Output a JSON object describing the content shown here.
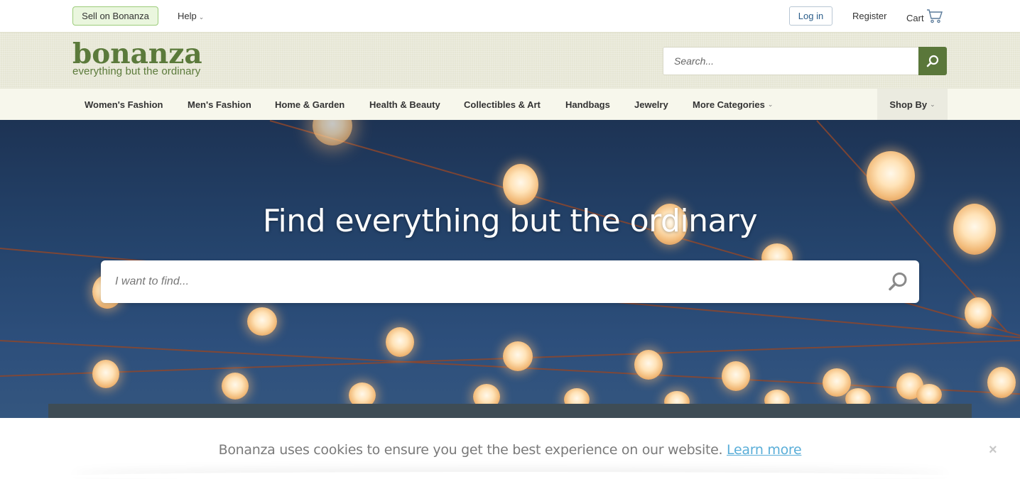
{
  "topbar": {
    "sell_label": "Sell on Bonanza",
    "help_label": "Help",
    "login_label": "Log in",
    "register_label": "Register",
    "cart_label": "Cart"
  },
  "header": {
    "logo_word": "bonanza",
    "logo_tagline": "everything but the ordinary",
    "search_placeholder": "Search..."
  },
  "catnav": {
    "items": [
      {
        "label": "Women's Fashion"
      },
      {
        "label": "Men's Fashion"
      },
      {
        "label": "Home & Garden"
      },
      {
        "label": "Health & Beauty"
      },
      {
        "label": "Collectibles & Art"
      },
      {
        "label": "Handbags"
      },
      {
        "label": "Jewelry"
      },
      {
        "label": "More Categories"
      }
    ],
    "shop_by_label": "Shop By"
  },
  "hero": {
    "title": "Find everything but the ordinary",
    "search_placeholder": "I want to find..."
  },
  "cookie": {
    "message": "Bonanza uses cookies to ensure you get the best experience on our website.",
    "link_label": "Learn more",
    "close_label": "×"
  },
  "colors": {
    "brand_green": "#5a773a",
    "link_blue": "#5aaed8",
    "hero_sky": "#24436b"
  },
  "icons": [
    "chevron-down-icon",
    "cart-icon",
    "search-icon",
    "close-icon"
  ]
}
